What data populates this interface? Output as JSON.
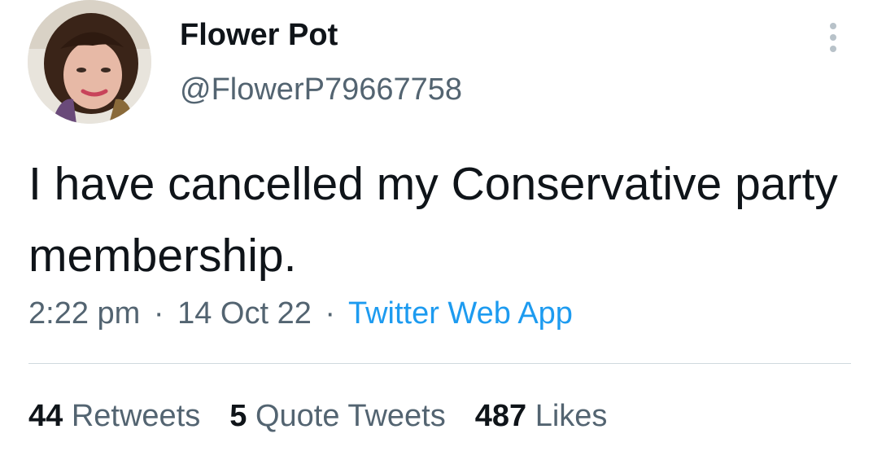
{
  "user": {
    "display_name": "Flower Pot",
    "handle": "@FlowerP79667758",
    "avatar_icon": "user-avatar"
  },
  "tweet": {
    "text": "I have cancelled my Conservative party membership."
  },
  "meta": {
    "time": "2:22 pm",
    "separator": "·",
    "date": "14 Oct 22",
    "source": "Twitter Web App"
  },
  "stats": {
    "retweets_count": "44",
    "retweets_label": "Retweets",
    "quotes_count": "5",
    "quotes_label": "Quote Tweets",
    "likes_count": "487",
    "likes_label": "Likes"
  },
  "colors": {
    "text_primary": "#0f1419",
    "text_secondary": "#536471",
    "link": "#1d9bf0",
    "divider": "#cfd9de"
  },
  "icons": {
    "more": "more-vertical-icon"
  }
}
